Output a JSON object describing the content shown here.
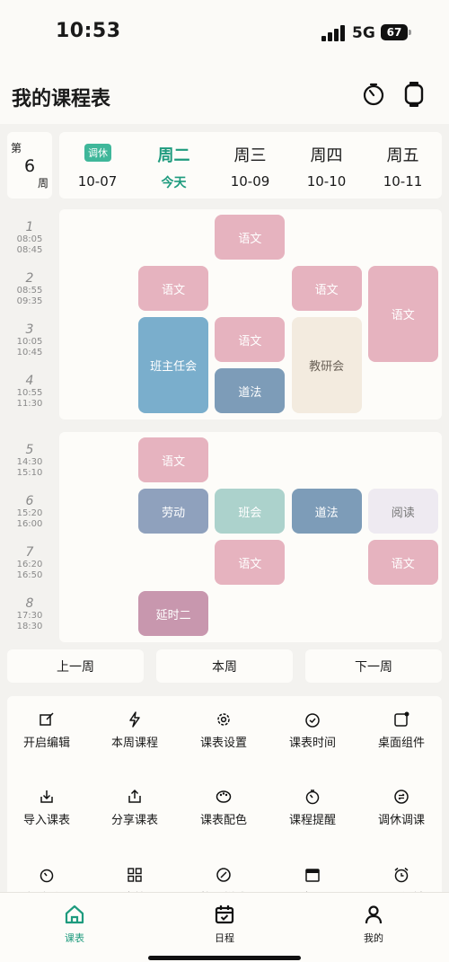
{
  "status_bar": {
    "time": "10:53",
    "network": "5G",
    "battery": "67"
  },
  "header": {
    "title": "我的课程表"
  },
  "week": {
    "prefix": "第",
    "number": "6",
    "suffix": "周"
  },
  "days": [
    {
      "name": "",
      "badge": "调休",
      "date": "10-07"
    },
    {
      "name": "周二",
      "date": "今天",
      "today": true
    },
    {
      "name": "周三",
      "date": "10-09"
    },
    {
      "name": "周四",
      "date": "10-10"
    },
    {
      "name": "周五",
      "date": "10-11"
    }
  ],
  "periods": [
    {
      "n": "1",
      "start": "08:05",
      "end": "08:45"
    },
    {
      "n": "2",
      "start": "08:55",
      "end": "09:35"
    },
    {
      "n": "3",
      "start": "10:05",
      "end": "10:45"
    },
    {
      "n": "4",
      "start": "10:55",
      "end": "11:30"
    },
    {
      "n": "5",
      "start": "14:30",
      "end": "15:10"
    },
    {
      "n": "6",
      "start": "15:20",
      "end": "16:00"
    },
    {
      "n": "7",
      "start": "16:20",
      "end": "16:50"
    },
    {
      "n": "8",
      "start": "17:30",
      "end": "18:30"
    }
  ],
  "lessons": [
    {
      "name": "语文",
      "day": 2,
      "start": 1,
      "span": 1,
      "color": "#e6b3bf"
    },
    {
      "name": "语文",
      "day": 1,
      "start": 2,
      "span": 1,
      "color": "#e6b3bf"
    },
    {
      "name": "语文",
      "day": 3,
      "start": 2,
      "span": 1,
      "color": "#e6b3bf"
    },
    {
      "name": "语文",
      "day": 4,
      "start": 2,
      "span": 2,
      "color": "#e6b3bf"
    },
    {
      "name": "班主任会",
      "day": 1,
      "start": 3,
      "span": 2,
      "color": "#7aaecc"
    },
    {
      "name": "语文",
      "day": 2,
      "start": 3,
      "span": 1,
      "color": "#e6b3bf"
    },
    {
      "name": "教研会",
      "day": 3,
      "start": 3,
      "span": 2,
      "color": "#f3ebdf",
      "text": "#6b6258"
    },
    {
      "name": "道法",
      "day": 2,
      "start": 4,
      "span": 1,
      "color": "#7d9cb8"
    },
    {
      "name": "语文",
      "day": 1,
      "start": 5,
      "span": 1,
      "color": "#e6b3bf"
    },
    {
      "name": "劳动",
      "day": 1,
      "start": 6,
      "span": 1,
      "color": "#8fa1bd"
    },
    {
      "name": "班会",
      "day": 2,
      "start": 6,
      "span": 1,
      "color": "#acd2cc"
    },
    {
      "name": "道法",
      "day": 3,
      "start": 6,
      "span": 1,
      "color": "#7d9cb8"
    },
    {
      "name": "阅读",
      "day": 4,
      "start": 6,
      "span": 1,
      "color": "#eeeaf1",
      "text": "#777"
    },
    {
      "name": "语文",
      "day": 2,
      "start": 7,
      "span": 1,
      "color": "#e6b3bf"
    },
    {
      "name": "语文",
      "day": 4,
      "start": 7,
      "span": 1,
      "color": "#e6b3bf"
    },
    {
      "name": "延时二",
      "day": 1,
      "start": 8,
      "span": 1,
      "color": "#c897ae"
    }
  ],
  "week_nav": {
    "prev": "上一周",
    "current": "本周",
    "next": "下一周"
  },
  "menu": [
    {
      "label": "开启编辑",
      "icon": "edit-icon"
    },
    {
      "label": "本周课程",
      "icon": "lightning-icon"
    },
    {
      "label": "课表设置",
      "icon": "gear-icon"
    },
    {
      "label": "课表时间",
      "icon": "clock-check-icon"
    },
    {
      "label": "桌面组件",
      "icon": "widget-icon"
    },
    {
      "label": "导入课表",
      "icon": "import-icon"
    },
    {
      "label": "分享课表",
      "icon": "share-icon"
    },
    {
      "label": "课表配色",
      "icon": "palette-icon"
    },
    {
      "label": "课程提醒",
      "icon": "reminder-icon"
    },
    {
      "label": "调休调课",
      "icon": "swap-icon"
    },
    {
      "label": "定时活动",
      "icon": "timer-icon"
    },
    {
      "label": "课表管理",
      "icon": "grid-icon"
    },
    {
      "label": "格子样式",
      "icon": "style-icon"
    },
    {
      "label": "课表日历",
      "icon": "calendar-icon"
    },
    {
      "label": "早起闹钟",
      "icon": "alarm-icon"
    }
  ],
  "tabs": [
    {
      "label": "课表",
      "icon": "home-icon",
      "active": true
    },
    {
      "label": "日程",
      "icon": "calendar-check-icon"
    },
    {
      "label": "我的",
      "icon": "user-icon"
    }
  ],
  "colors": {
    "accent": "#1e9b7e",
    "badge": "#3fb79a"
  }
}
